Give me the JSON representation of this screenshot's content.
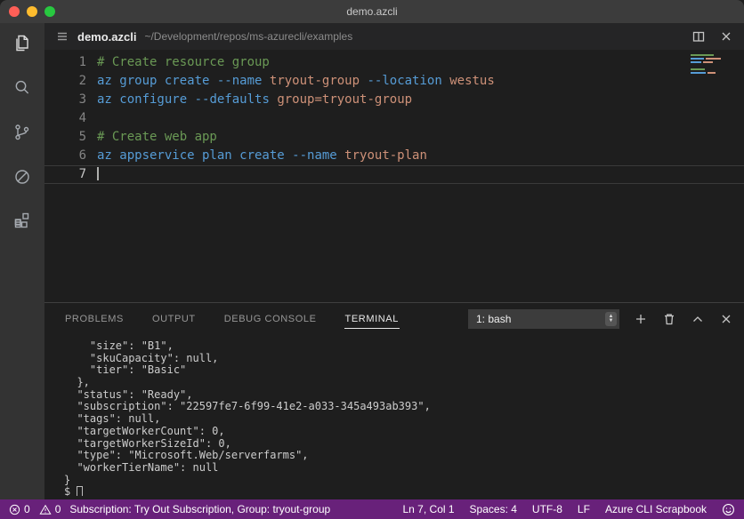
{
  "window": {
    "title": "demo.azcli"
  },
  "activity_bar": {
    "items": [
      "explorer",
      "search",
      "source-control",
      "debug",
      "extensions"
    ]
  },
  "editor_header": {
    "file_name": "demo.azcli",
    "file_path": "~/Development/repos/ms-azurecli/examples"
  },
  "editor": {
    "lines": [
      {
        "num": "1",
        "tokens": [
          {
            "t": "# Create resource group",
            "c": "comment"
          }
        ]
      },
      {
        "num": "2",
        "tokens": [
          {
            "t": "az group create",
            "c": "cmd"
          },
          {
            "t": " ",
            "c": "plain"
          },
          {
            "t": "--name",
            "c": "flag"
          },
          {
            "t": " ",
            "c": "plain"
          },
          {
            "t": "tryout-group",
            "c": "val"
          },
          {
            "t": " ",
            "c": "plain"
          },
          {
            "t": "--location",
            "c": "flag"
          },
          {
            "t": " ",
            "c": "plain"
          },
          {
            "t": "westus",
            "c": "val"
          }
        ]
      },
      {
        "num": "3",
        "tokens": [
          {
            "t": "az configure",
            "c": "cmd"
          },
          {
            "t": " ",
            "c": "plain"
          },
          {
            "t": "--defaults",
            "c": "flag"
          },
          {
            "t": " ",
            "c": "plain"
          },
          {
            "t": "group=tryout-group",
            "c": "val"
          }
        ]
      },
      {
        "num": "4",
        "tokens": []
      },
      {
        "num": "5",
        "tokens": [
          {
            "t": "# Create web app",
            "c": "comment"
          }
        ]
      },
      {
        "num": "6",
        "tokens": [
          {
            "t": "az appservice plan create",
            "c": "cmd"
          },
          {
            "t": " ",
            "c": "plain"
          },
          {
            "t": "--name",
            "c": "flag"
          },
          {
            "t": " ",
            "c": "plain"
          },
          {
            "t": "tryout-plan",
            "c": "val"
          }
        ]
      },
      {
        "num": "7",
        "tokens": [],
        "current": true,
        "cursor": true
      }
    ]
  },
  "panel": {
    "tabs": [
      {
        "label": "PROBLEMS",
        "active": false
      },
      {
        "label": "OUTPUT",
        "active": false
      },
      {
        "label": "DEBUG CONSOLE",
        "active": false
      },
      {
        "label": "TERMINAL",
        "active": true
      }
    ],
    "terminal_selector": "1: bash"
  },
  "terminal": {
    "lines": [
      "    \"size\": \"B1\",",
      "    \"skuCapacity\": null,",
      "    \"tier\": \"Basic\"",
      "  },",
      "  \"status\": \"Ready\",",
      "  \"subscription\": \"22597fe7-6f99-41e2-a033-345a493ab393\",",
      "  \"tags\": null,",
      "  \"targetWorkerCount\": 0,",
      "  \"targetWorkerSizeId\": 0,",
      "  \"type\": \"Microsoft.Web/serverfarms\",",
      "  \"workerTierName\": null",
      "}",
      "$ "
    ]
  },
  "status_bar": {
    "error_count": "0",
    "warning_count": "0",
    "message": "Subscription: Try Out Subscription, Group: tryout-group",
    "right_items": [
      "Ln 7, Col 1",
      "Spaces: 4",
      "UTF-8",
      "LF",
      "Azure CLI Scrapbook"
    ]
  },
  "colors": {
    "status_bar_bg": "#68217a",
    "comment": "#6a9955",
    "command": "#569cd6",
    "flag": "#569cd6",
    "value": "#ce9178",
    "editor_bg": "#1e1e1e",
    "activity_bar_bg": "#333333",
    "title_bar_bg": "#3c3c3c"
  }
}
